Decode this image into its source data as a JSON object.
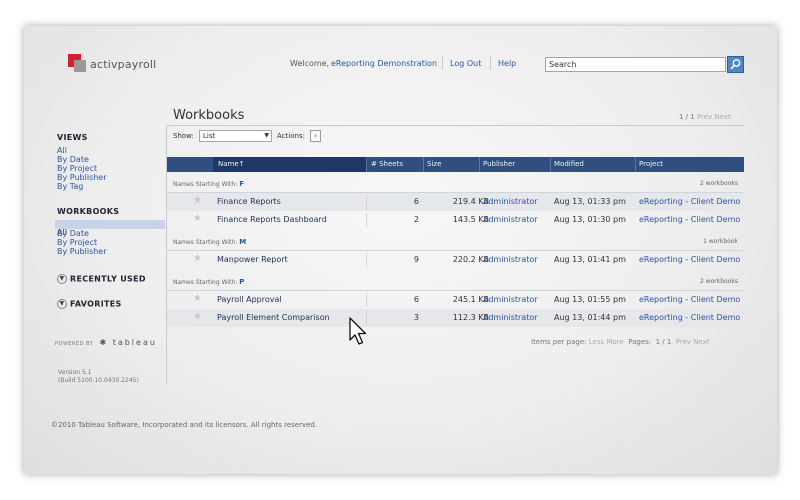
{
  "header": {
    "logo_text": "activpayroll",
    "welcome_label": "Welcome,",
    "user_name": "eReporting Demonstration",
    "logout_label": "Log Out",
    "help_label": "Help",
    "search_placeholder": "Search",
    "search_icon": "search-icon"
  },
  "sidebar": {
    "views_title": "VIEWS",
    "views_items": [
      "All",
      "By Date",
      "By Project",
      "By Publisher",
      "By Tag"
    ],
    "workbooks_title": "WORKBOOKS",
    "workbooks_items": [
      "All",
      "By Date",
      "By Project",
      "By Publisher"
    ],
    "workbooks_selected": "All",
    "recently_used_label": "RECENTLY USED",
    "favorites_label": "FAVORITES",
    "powered_by_label": "POWERED BY",
    "powered_by_brand": "tableau",
    "version_line1": "Version 5.1",
    "version_line2": "(Build 5100.10.0430.2245)"
  },
  "main": {
    "title": "Workbooks",
    "top_pager": {
      "text": "1 / 1",
      "prev": "Prev",
      "next": "Next"
    },
    "show_label": "Show:",
    "show_value": "List",
    "actions_label": "Actions:",
    "actions_icon": "chevron-right-icon",
    "columns": {
      "name": "Name↑",
      "sheets": "# Sheets",
      "size": "Size",
      "publisher": "Publisher",
      "modified": "Modified",
      "project": "Project"
    },
    "group_prefix": "Names Starting With:",
    "groups": [
      {
        "letter": "F",
        "count": "2 workbooks"
      },
      {
        "letter": "M",
        "count": "1 workbook"
      },
      {
        "letter": "P",
        "count": "2 workbooks"
      }
    ],
    "rows": [
      {
        "name": "Finance Reports",
        "sheets": "6",
        "size": "219.4 KB",
        "publisher": "Administrator",
        "modified": "Aug 13, 01:33 pm",
        "project": "eReporting - Client Demo"
      },
      {
        "name": "Finance Reports Dashboard",
        "sheets": "2",
        "size": "143.5 KB",
        "publisher": "Administrator",
        "modified": "Aug 13, 01:30 pm",
        "project": "eReporting - Client Demo"
      },
      {
        "name": "Manpower Report",
        "sheets": "9",
        "size": "220.2 KB",
        "publisher": "Administrator",
        "modified": "Aug 13, 01:41 pm",
        "project": "eReporting - Client Demo"
      },
      {
        "name": "Payroll Approval",
        "sheets": "6",
        "size": "245.1 KB",
        "publisher": "Administrator",
        "modified": "Aug 13, 01:55 pm",
        "project": "eReporting - Client Demo"
      },
      {
        "name": "Payroll Element Comparison",
        "sheets": "3",
        "size": "112.3 KB",
        "publisher": "Administrator",
        "modified": "Aug 13, 01:44 pm",
        "project": "eReporting - Client Demo"
      }
    ],
    "footer_pager": {
      "items_per_page_label": "Items per page:",
      "less": "Less",
      "more": "More",
      "pages_label": "Pages:",
      "pages": "1 / 1",
      "prev": "Prev",
      "next": "Next"
    }
  },
  "copyright": "©2010 Tableau Software, Incorporated and its licensors. All rights reserved.",
  "colors": {
    "accent_blue": "#2c56a0",
    "table_header": "#2f4f7f",
    "logo_red": "#d51e2e"
  }
}
